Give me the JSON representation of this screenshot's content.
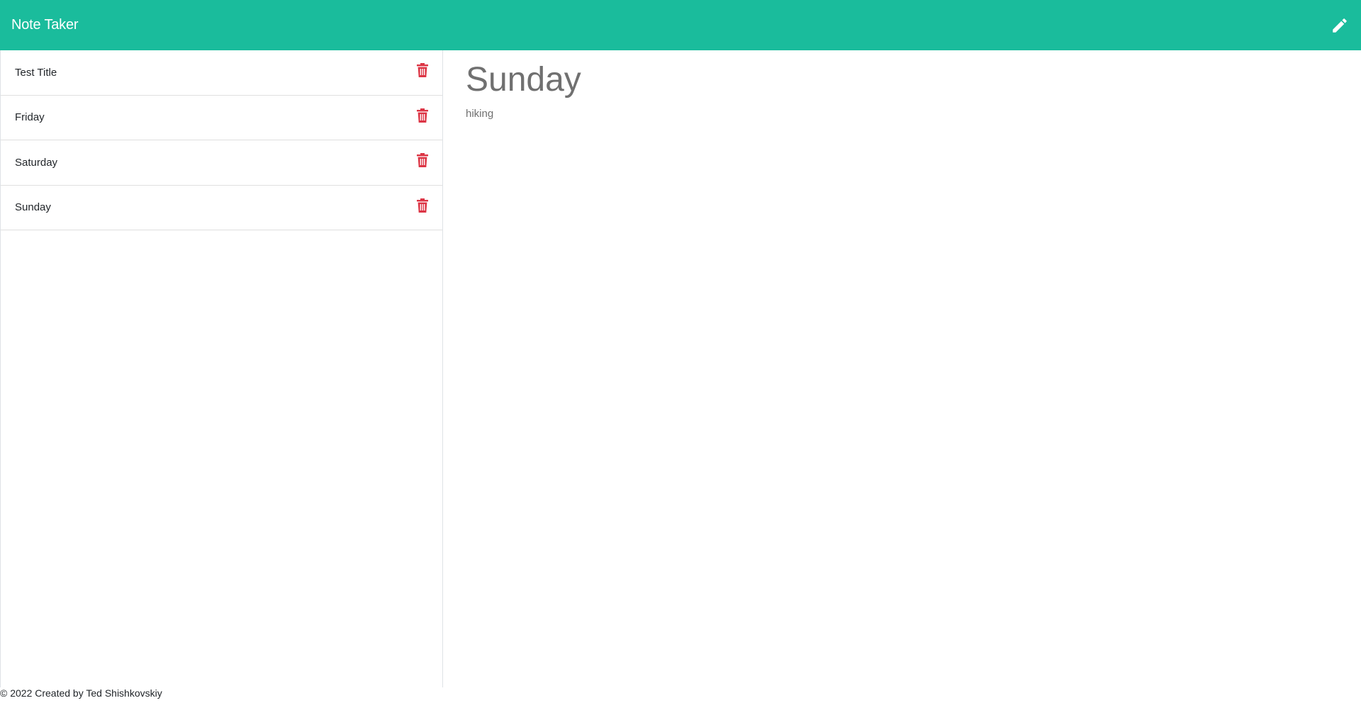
{
  "navbar": {
    "brand": "Note Taker",
    "new_note_icon": "pencil-icon",
    "color": "#1abc9c"
  },
  "notes": [
    {
      "title": "Test Title"
    },
    {
      "title": "Friday"
    },
    {
      "title": "Saturday"
    },
    {
      "title": "Sunday"
    }
  ],
  "delete_icon": "trash-icon",
  "delete_color": "#dc3545",
  "active_note": {
    "title": "Sunday",
    "text": "hiking"
  },
  "footer": {
    "text": "© 2022 Created by Ted Shishkovskiy"
  }
}
